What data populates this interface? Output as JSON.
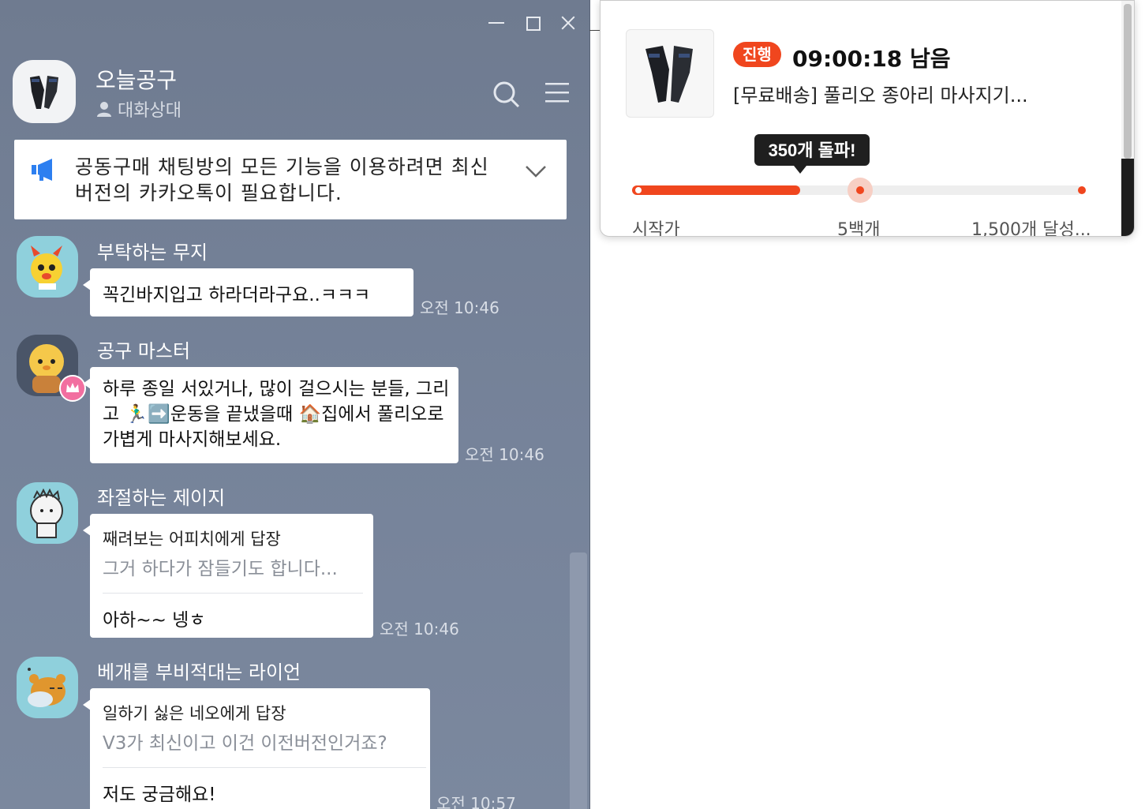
{
  "chat": {
    "room_title": "오늘공구",
    "room_subtitle": "대화상대",
    "notice_text": "공동구매 채팅방의 모든 기능을 이용하려면 최신 버전의 카카오톡이 필요합니다.",
    "messages": [
      {
        "sender": "부탁하는 무지",
        "text": "꼭긴바지입고 하라더라구요..ㅋㅋㅋ",
        "time": "오전 10:46"
      },
      {
        "sender": "공구 마스터",
        "text": "하루 종일 서있거나, 많이 걸으시는 분들, 그리고 🏃‍♂️➡️운동을 끝냈을때 🏠집에서 풀리오로 가볍게 마사지해보세요.",
        "time": "오전 10:46"
      },
      {
        "sender": "좌절하는 제이지",
        "reply_to": "째려보는 어피치에게 답장",
        "quote": "그거 하다가 잠들기도 합니다...",
        "text": "아하~~ 넹ㅎ",
        "time": "오전 10:46"
      },
      {
        "sender": "베개를 부비적대는 라이언",
        "reply_to": "일하기 싫은 네오에게 답장",
        "quote": "V3가 최신이고 이건 이전버전인거죠?",
        "text": "저도 궁금해요!",
        "time": "오전 10:57"
      }
    ]
  },
  "deal": {
    "status": "진행",
    "countdown": "09:00:18 남음",
    "product_name": "[무료배송] 풀리오 종아리 마사지기...",
    "milestone_tooltip": "350개 돌파!",
    "progress_fraction": 0.35,
    "labels": [
      "시작가",
      "5백개",
      "1,500개 달성..."
    ],
    "accent_color": "#f0461e"
  }
}
